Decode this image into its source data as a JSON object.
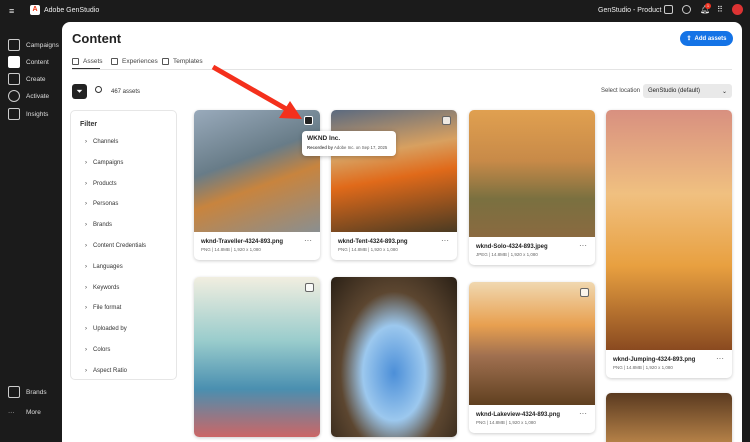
{
  "app": {
    "title": "Adobe GenStudio",
    "org": "GenStudio - Product",
    "notif_count": "1"
  },
  "sidebar": {
    "items": [
      {
        "label": "Campaigns"
      },
      {
        "label": "Content"
      },
      {
        "label": "Create"
      },
      {
        "label": "Activate"
      },
      {
        "label": "Insights"
      }
    ],
    "bottom": [
      {
        "label": "Brands"
      },
      {
        "label": "More"
      }
    ]
  },
  "page": {
    "title": "Content",
    "add_label": "Add assets",
    "tabs": [
      "Assets",
      "Experiences",
      "Templates"
    ],
    "count": "467 assets",
    "location_label": "Select location",
    "location_value": "GenStudio (default)"
  },
  "filter": {
    "title": "Filter",
    "items": [
      "Channels",
      "Campaigns",
      "Products",
      "Personas",
      "Brands",
      "Content Credentials",
      "Languages",
      "Keywords",
      "File format",
      "Uploaded by",
      "Colors",
      "Aspect Ratio"
    ]
  },
  "tooltip": {
    "title": "WKND Inc.",
    "by_label": "Recorded by",
    "by_value": "Adobe Inc. on Sep 17, 2025"
  },
  "assets": [
    {
      "name": "wknd-Traveller-4324-893.png",
      "meta": "PNG | 14.8MB | 1,920 x 1,080"
    },
    {
      "name": "wknd-Tent-4324-893.png",
      "meta": "PNG | 14.8MB | 1,920 x 1,080"
    },
    {
      "name": "wknd-Solo-4324-893.jpeg",
      "meta": "JPEG | 14.8MB | 1,920 x 1,080"
    },
    {
      "name": "wknd-Jumping-4324-893.png",
      "meta": "PNG | 14.8MB | 1,920 x 1,080"
    },
    {
      "name": "wknd-Lakeview-4324-893.png",
      "meta": "PNG | 14.8MB | 1,920 x 1,080"
    }
  ],
  "colors": {
    "accent": "#1473e6",
    "arrow": "#f4301c",
    "dark": "#1b1b1b"
  }
}
